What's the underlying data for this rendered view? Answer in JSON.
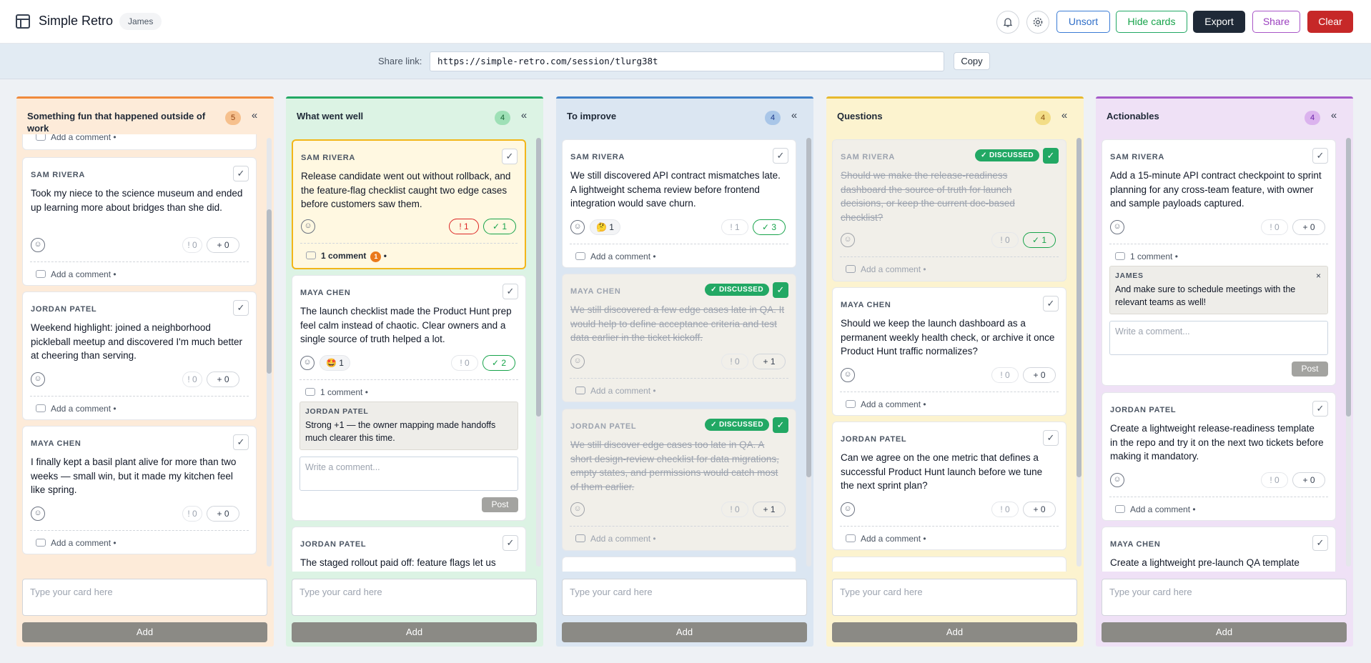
{
  "app": {
    "title": "Simple Retro",
    "user": "James"
  },
  "toolbar": {
    "unsort": "Unsort",
    "hide_cards": "Hide cards",
    "export": "Export",
    "share": "Share",
    "clear": "Clear"
  },
  "share": {
    "label": "Share link:",
    "url": "https://simple-retro.com/session/tlurg38t",
    "copy": "Copy"
  },
  "common": {
    "add_comment": "Add a comment",
    "bullet": "•",
    "write_comment": "Write a comment...",
    "post": "Post",
    "type_card": "Type your card here",
    "add": "Add",
    "collapse": "«",
    "discussed": "DISCUSSED",
    "check": "✓",
    "close": "×"
  },
  "columns": [
    {
      "title": "Something fun that happened outside of work",
      "count": "5",
      "accent": "#f08a3c",
      "bg": "#fdebd9"
    },
    {
      "title": "What went well",
      "count": "4",
      "accent": "#22a864",
      "bg": "#dcf3e4"
    },
    {
      "title": "To improve",
      "count": "4",
      "accent": "#3e7fc7",
      "bg": "#dbe6f2"
    },
    {
      "title": "Questions",
      "count": "4",
      "accent": "#e7b92d",
      "bg": "#fcf3cf"
    },
    {
      "title": "Actionables",
      "count": "4",
      "accent": "#a55ac9",
      "bg": "#efe1f6"
    }
  ],
  "cards": {
    "c0": [
      {
        "author": "SAM RIVERA",
        "text": "Took my niece to the science museum and ended up learning more about bridges than she did.",
        "bad": "0",
        "plus": "+ 0"
      },
      {
        "author": "JORDAN PATEL",
        "text": "Weekend highlight: joined a neighborhood pickleball meetup and discovered I'm much better at cheering than serving.",
        "bad": "0",
        "plus": "+ 0"
      },
      {
        "author": "MAYA CHEN",
        "text": "I finally kept a basil plant alive for more than two weeks — small win, but it made my kitchen feel like spring.",
        "bad": "0",
        "plus": "+ 0"
      }
    ],
    "c1": [
      {
        "author": "SAM RIVERA",
        "text": "Release candidate went out without rollback, and the feature-flag checklist caught two edge cases before customers saw them.",
        "bad": "1",
        "ok": "1",
        "comments": "1 comment",
        "comment_badge": "1"
      },
      {
        "author": "MAYA CHEN",
        "text": "The launch checklist made the Product Hunt prep feel calm instead of chaotic. Clear owners and a single source of truth helped a lot.",
        "emoji": "🤩",
        "emoji_count": "1",
        "bad": "0",
        "ok": "2",
        "comments": "1 comment",
        "comment_author": "JORDAN PATEL",
        "comment_text": "Strong +1 — the owner mapping made handoffs much clearer this time."
      },
      {
        "author": "JORDAN PATEL",
        "text": "The staged rollout paid off: feature flags let us"
      }
    ],
    "c2": [
      {
        "author": "SAM RIVERA",
        "text": "We still discovered API contract mismatches late. A lightweight schema review before frontend integration would save churn.",
        "emoji": "🤔",
        "emoji_count": "1",
        "bad": "1",
        "ok": "3"
      },
      {
        "author": "MAYA CHEN",
        "text": "We still discovered a few edge cases late in QA. It would help to define acceptance criteria and test data earlier in the ticket kickoff.",
        "bad": "0",
        "plus": "+ 1"
      },
      {
        "author": "JORDAN PATEL",
        "text": "We still discover edge cases too late in QA. A short design-review checklist for data migrations, empty states, and permissions would catch most of them earlier.",
        "bad": "0",
        "plus": "+ 1"
      }
    ],
    "c3": [
      {
        "author": "SAM RIVERA",
        "text": "Should we make the release-readiness dashboard the source of truth for launch decisions, or keep the current doc-based checklist?",
        "bad": "0",
        "ok": "1"
      },
      {
        "author": "MAYA CHEN",
        "text": "Should we keep the launch dashboard as a permanent weekly health check, or archive it once Product Hunt traffic normalizes?",
        "bad": "0",
        "plus": "+ 0"
      },
      {
        "author": "JORDAN PATEL",
        "text": "Can we agree on the one metric that defines a successful Product Hunt launch before we tune the next sprint plan?",
        "bad": "0",
        "plus": "+ 0"
      }
    ],
    "c4": [
      {
        "author": "SAM RIVERA",
        "text": "Add a 15-minute API contract checkpoint to sprint planning for any cross-team feature, with owner and sample payloads captured.",
        "bad": "0",
        "plus": "+ 0",
        "comments": "1 comment",
        "comment_author": "JAMES",
        "comment_text": "And make sure to schedule meetings with the relevant teams as well!"
      },
      {
        "author": "JORDAN PATEL",
        "text": "Create a lightweight release-readiness template in the repo and try it on the next two tickets before making it mandatory.",
        "bad": "0",
        "plus": "+ 0"
      },
      {
        "author": "MAYA CHEN",
        "text": "Create a lightweight pre-launch QA template"
      }
    ]
  }
}
